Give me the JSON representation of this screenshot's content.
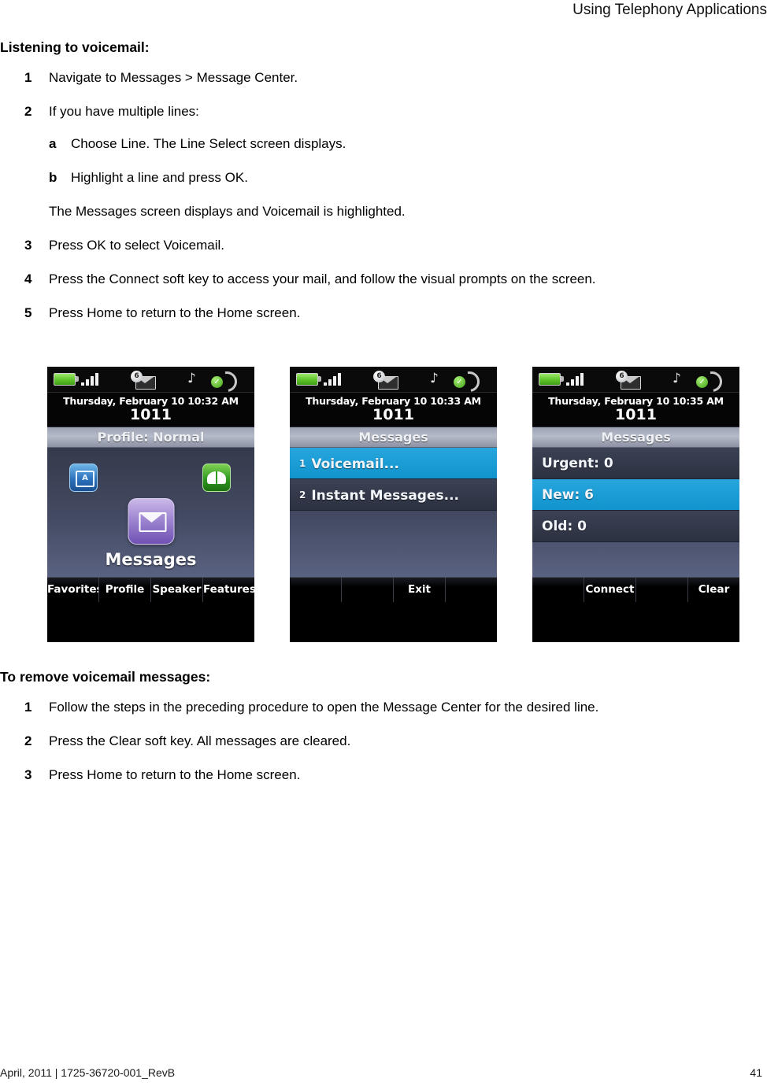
{
  "header": {
    "running_head": "Using Telephony Applications"
  },
  "section1": {
    "heading": "Listening to voicemail:",
    "steps": [
      {
        "num": "1",
        "parts": [
          {
            "t": "Navigate to ",
            "b": false
          },
          {
            "t": "Messages > Message Center",
            "b": true
          },
          {
            "t": ".",
            "b": false
          }
        ]
      },
      {
        "num": "2",
        "parts": [
          {
            "t": "If you have multiple lines:",
            "b": false
          }
        ],
        "substeps": [
          {
            "num": "a",
            "parts": [
              {
                "t": "Choose ",
                "b": false
              },
              {
                "t": "Line",
                "b": true
              },
              {
                "t": ". The Line Select screen displays.",
                "b": false
              }
            ]
          },
          {
            "num": "b",
            "parts": [
              {
                "t": "Highlight a line and press ",
                "b": false
              },
              {
                "t": "OK",
                "b": true
              },
              {
                "t": ".",
                "b": false
              }
            ]
          }
        ],
        "note": "The Messages screen displays and Voicemail is highlighted."
      },
      {
        "num": "3",
        "parts": [
          {
            "t": "Press ",
            "b": false
          },
          {
            "t": "OK",
            "b": true
          },
          {
            "t": " to select Voicemail.",
            "b": false
          }
        ]
      },
      {
        "num": "4",
        "parts": [
          {
            "t": "Press the ",
            "b": false
          },
          {
            "t": "Connect",
            "b": true
          },
          {
            "t": " soft key to access your mail, and follow the visual prompts on the screen.",
            "b": false
          }
        ]
      },
      {
        "num": "5",
        "parts": [
          {
            "t": "Press ",
            "b": false
          },
          {
            "t": "Home",
            "b": true
          },
          {
            "t": " to return to the Home screen.",
            "b": false
          }
        ]
      }
    ]
  },
  "figure": {
    "screens": [
      {
        "name": "home-screen",
        "statusbar": {
          "battery_icon": "battery-full-icon",
          "signal_icon": "signal-bars-icon",
          "message_icon": "message-envelope-icon",
          "message_badge": "6",
          "ringer_icon": "music-note-icon",
          "headset_icon": "headset-enabled-icon"
        },
        "datetime": "Thursday, February 10 10:32 AM",
        "extension": "1011",
        "title": "Profile: Normal",
        "type": "home",
        "home_icons": [
          {
            "name": "directories-icon",
            "glyph": "A"
          },
          {
            "name": "applications-book-icon",
            "glyph": ""
          }
        ],
        "main_icon_name": "messages-icon",
        "main_label": "Messages",
        "softkeys": [
          "Favorites",
          "Profile",
          "Speaker",
          "Features"
        ]
      },
      {
        "name": "messages-menu-screen",
        "statusbar": {
          "battery_icon": "battery-full-icon",
          "signal_icon": "signal-bars-icon",
          "message_icon": "message-envelope-icon",
          "message_badge": "6",
          "ringer_icon": "music-note-icon",
          "headset_icon": "headset-enabled-icon"
        },
        "datetime": "Thursday, February 10 10:33 AM",
        "extension": "1011",
        "title": "Messages",
        "type": "list",
        "rows": [
          {
            "index": "1",
            "label": "Voicemail...",
            "selected": true
          },
          {
            "index": "2",
            "label": "Instant Messages...",
            "selected": false
          }
        ],
        "softkeys": [
          "",
          "",
          "Exit",
          ""
        ]
      },
      {
        "name": "message-center-screen",
        "statusbar": {
          "battery_icon": "battery-full-icon",
          "signal_icon": "signal-bars-icon",
          "message_icon": "message-envelope-icon",
          "message_badge": "6",
          "ringer_icon": "music-note-icon",
          "headset_icon": "headset-enabled-icon"
        },
        "datetime": "Thursday, February 10 10:35 AM",
        "extension": "1011",
        "title": "Messages",
        "type": "list",
        "rows": [
          {
            "index": "",
            "label": "Urgent: 0",
            "selected": false
          },
          {
            "index": "",
            "label": "New: 6",
            "selected": true
          },
          {
            "index": "",
            "label": "Old: 0",
            "selected": false
          }
        ],
        "softkeys": [
          "",
          "Connect",
          "",
          "Clear"
        ]
      }
    ],
    "colors": {
      "selection_blue": "#1193cc",
      "battery_green": "#5fc32c",
      "screen_bg_top": "#353a4c",
      "screen_bg_bottom": "#636c8e",
      "titlebar_gray": "#b6bbc8"
    }
  },
  "section2": {
    "heading": "To remove voicemail messages:",
    "steps": [
      {
        "num": "1",
        "parts": [
          {
            "t": "Follow the steps in the preceding procedure to open the Message Center for the desired line.",
            "b": false
          }
        ]
      },
      {
        "num": "2",
        "parts": [
          {
            "t": "Press the ",
            "b": false
          },
          {
            "t": "Clear",
            "b": true
          },
          {
            "t": " soft key. All messages are cleared.",
            "b": false
          }
        ]
      },
      {
        "num": "3",
        "parts": [
          {
            "t": "Press ",
            "b": false
          },
          {
            "t": "Home",
            "b": true
          },
          {
            "t": " to return to the Home screen.",
            "b": false
          }
        ]
      }
    ]
  },
  "footer": {
    "left": "April, 2011  |  1725-36720-001_RevB",
    "page": "41"
  }
}
